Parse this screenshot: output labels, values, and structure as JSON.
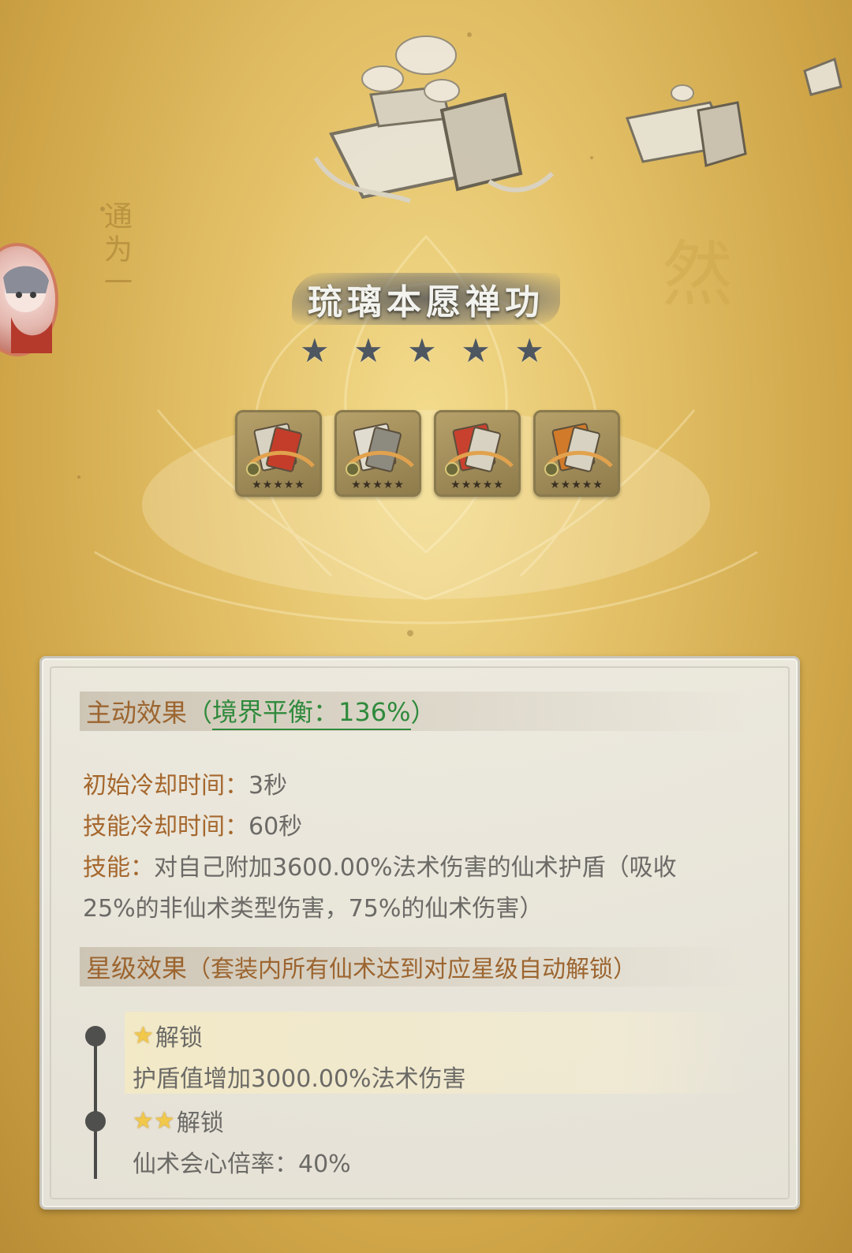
{
  "header": {
    "title": "琉璃本愿禅功",
    "star_count": 5
  },
  "items": [
    {
      "stars": "★★★★★"
    },
    {
      "stars": "★★★★★"
    },
    {
      "stars": "★★★★★"
    },
    {
      "stars": "★★★★★"
    }
  ],
  "active_effect": {
    "title": "主动效果",
    "paren_open": "（",
    "balance_label": "境界平衡：136%",
    "paren_close": "）",
    "initial_cd_label": "初始冷却时间：",
    "initial_cd_value": "3秒",
    "skill_cd_label": "技能冷却时间：",
    "skill_cd_value": "60秒",
    "skill_label": "技能：",
    "skill_text_1": "对自己附加3600.00%法术伤害的仙术护盾（吸收",
    "skill_text_2": "25%的非仙术类型伤害，75%的仙术伤害）"
  },
  "star_effect": {
    "title": "星级效果",
    "subtitle": "（套装内所有仙术达到对应星级自动解锁）",
    "tiers": [
      {
        "stars": "★",
        "unlock": "解锁",
        "effect": "护盾值增加3000.00%法术伤害",
        "active": true
      },
      {
        "stars": "★★",
        "unlock": "解锁",
        "effect": "仙术会心倍率：40%",
        "active": false
      }
    ]
  },
  "background_text": {
    "left_small_1": "通为一",
    "right_big": "然"
  },
  "colors": {
    "label_brown": "#a5672d",
    "balance_green": "#2f8a3c",
    "star_gold": "#f2c84a",
    "title_star_grey": "#4e5660"
  }
}
